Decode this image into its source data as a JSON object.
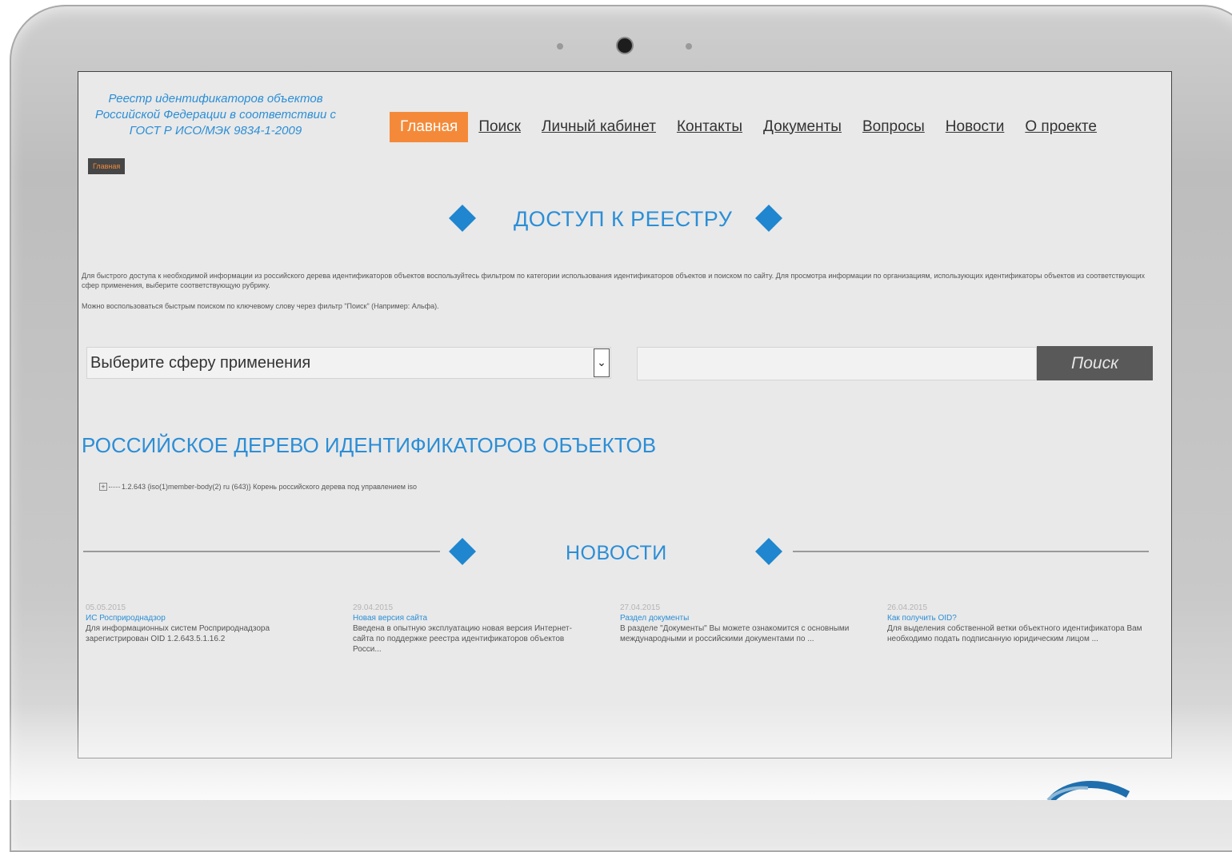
{
  "site": {
    "title": "Реестр идентификаторов объектов Российской Федерации в соответствии с ГОСТ Р ИСО/МЭК 9834-1-2009"
  },
  "nav": {
    "items": [
      "Главная",
      "Поиск",
      "Личный кабинет",
      "Контакты",
      "Документы",
      "Вопросы",
      "Новости",
      "О проекте"
    ],
    "active": "Главная"
  },
  "breadcrumb": {
    "label": "Главная"
  },
  "access": {
    "heading": "ДОСТУП К РЕЕСТРУ",
    "intro_1": "Для быстрого доступа к необходимой информации из российского дерева идентификаторов объектов воспользуйтесь фильтром по категории использования идентификаторов объектов и поиском по сайту. Для просмотра информации по организациям, использующих идентификаторы объектов из соответствующих сфер применения, выберите соответствующую рубрику.",
    "intro_2": "Можно воспользоваться быстрым поиском по ключевому слову через фильтр \"Поиск\" (Например: Альфа).",
    "select_value": "Выберите сферу применения",
    "search_value": "",
    "search_button": "Поиск"
  },
  "tree": {
    "heading": "РОССИЙСКОЕ ДЕРЕВО ИДЕНТИФИКАТОРОВ ОБЪЕКТОВ",
    "node_expander": "+",
    "node": "1.2.643 {iso(1)member-body(2) ru (643)} Корень российского дерева под управлением iso"
  },
  "news": {
    "heading": "НОВОСТИ",
    "items": [
      {
        "date": "05.05.2015",
        "title": "ИС Росприроднадзор",
        "text": "Для информационных систем Росприроднадзора зарегистрирован OID 1.2.643.5.1.16.2"
      },
      {
        "date": "29.04.2015",
        "title": "Новая версия сайта",
        "text": "Введена в опытную эксплуатацию новая версия Интернет-сайта по поддержке реестра идентификаторов объектов Росси..."
      },
      {
        "date": "27.04.2015",
        "title": "Раздел документы",
        "text": "В разделе \"Документы\" Вы можете ознакомится с основными международными и российскими документами по ..."
      },
      {
        "date": "26.04.2015",
        "title": "Как получить OID?",
        "text": "Для выделения собственной ветки объектного идентификатора Вам необходимо подать подписанную юридическим лицом ..."
      }
    ]
  },
  "colors": {
    "accent": "#f48a39",
    "link_blue": "#2b8ed6",
    "diamond_blue": "#1f86cf",
    "button_gray": "#595959"
  }
}
